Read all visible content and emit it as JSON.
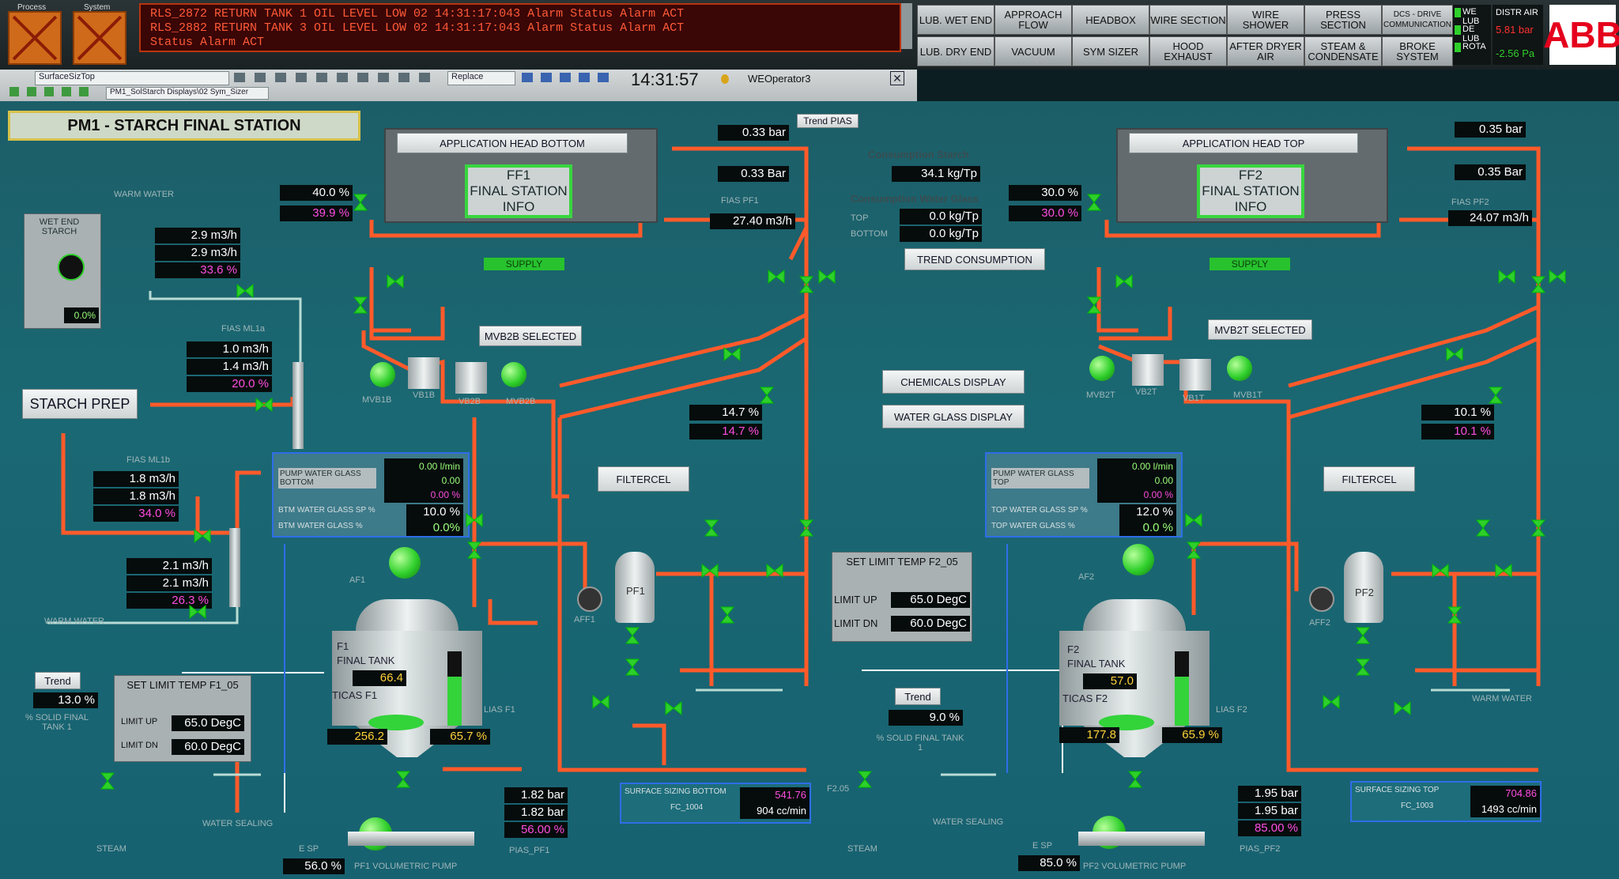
{
  "header": {
    "alarm_lines": [
      "RLS_2872      RETURN TANK 1 OIL LEVEL LOW    02 14:31:17:043  Alarm          Status Alarm    ACT",
      "RLS_2882      RETURN TANK 3 OIL LEVEL LOW    02 14:31:17:043  Alarm          Status Alarm    ACT",
      "                                                                             Status Alarm    ACT"
    ],
    "left_tabs": [
      "Process",
      "System"
    ],
    "nav_buttons_row1": [
      "LUB. WET END",
      "APPROACH FLOW",
      "HEADBOX",
      "WIRE SECTION",
      "WIRE SHOWER",
      "PRESS SECTION",
      "DCS - DRIVE COMMUNICATION"
    ],
    "nav_buttons_row2": [
      "LUB. DRY END",
      "VACUUM",
      "SYM SIZER",
      "HOOD EXHAUST",
      "AFTER DRYER AIR",
      "STEAM & CONDENSATE",
      "BROKE SYSTEM"
    ],
    "status_small": [
      "WE LUB",
      "DE LUB",
      "ROTA"
    ],
    "distr_air_label": "DISTR AIR",
    "distr_air_value1": "5.81 bar",
    "distr_air_value2": "-2.56 Pa",
    "logo": "ABB"
  },
  "toolbar": {
    "combo1": "SurfaceSizTop",
    "combo2": "PM1_SolStarch Displays\\02 Sym_Sizer",
    "replace": "Replace",
    "clock": "14:31:57",
    "user": "WEOperator3"
  },
  "page_title": "PM1 -  STARCH  FINAL STATION",
  "trend_pias": "Trend PIAS",
  "left": {
    "app_head_title": "APPLICATION HEAD BOTTOM",
    "info": [
      "FF1",
      "FINAL STATION",
      "INFO"
    ],
    "supply": "SUPPLY",
    "pias_top": "0.33 bar",
    "pias_2": "0.33 Bar",
    "fias_pf1": "FIAS PF1",
    "flow_pf1": "27.40 m3/h",
    "valve_pos1": "40.0 %",
    "valve_sp1": "39.9 %",
    "warm_water": "WARM WATER",
    "wet_end_starch": "WET END STARCH",
    "wet_end_value": "0.0%",
    "mlb_flows": [
      "2.9 m3/h",
      "2.9 m3/h",
      "33.6 %"
    ],
    "fias_ml1a": "FIAS ML1a",
    "ml1a_flows": [
      "1.0 m3/h",
      "1.4 m3/h",
      "20.0 %"
    ],
    "starch_prep": "STARCH PREP",
    "fias_ml1b": "FIAS ML1b",
    "ml1b_flows": [
      "1.8 m3/h",
      "1.8 m3/h",
      "34.0 %"
    ],
    "ml1c_flows": [
      "2.1 m3/h",
      "2.1 m3/h",
      "26.3 %"
    ],
    "mvb2b_selected": "MVB2B SELECTED",
    "pump_mixers": [
      "MVB1B",
      "VB1B",
      "VB2B",
      "MVB2B"
    ],
    "pump_water_glass": "PUMP WATER GLASS BOTTOM",
    "pwg_vals": [
      "0.00 l/min",
      "0.00",
      "0.00 %"
    ],
    "btm_wg_sp": "BTM WATER GLASS SP %",
    "btm_wg_sp_val": "10.0 %",
    "btm_wg": "BTM WATER GLASS %",
    "btm_wg_val": "0.0%",
    "filtercel": "FILTERCEL",
    "valve23_vals": [
      "14.7 %",
      "14.7 %"
    ],
    "af": "AF1",
    "pf": "PF1",
    "aff": "AFF1",
    "tank_label": [
      "F1",
      "FINAL TANK"
    ],
    "tank_level": "66.4",
    "ticas": "TICAS F1",
    "tank_temp": "256.2",
    "tank_pct": "65.7 %",
    "lias": "LIAS F1",
    "trend": "Trend",
    "solid_val": "13.0 %",
    "solid_label": "% SOLID FINAL TANK 1",
    "setlimit_title": "SET LIMIT TEMP F1_05",
    "limit_up": "LIMIT UP",
    "limit_up_val": "65.0 DegC",
    "limit_dn": "LIMIT DN",
    "limit_dn_val": "60.0 DegC",
    "steam": "STEAM",
    "water_sealing": "WATER SEALING",
    "pump_press": [
      "1.82 bar",
      "1.82 bar",
      "56.00 %"
    ],
    "pias_pf": "PIAS_PF1",
    "esp_val": "56.0 %",
    "esp": "E SP",
    "volumetric": "PF1 VOLUMETRIC PUMP",
    "surface_sizing": "SURFACE SIZING BOTTOM",
    "fc": "FC_1004",
    "ss_vals": [
      "541.76 cc/min",
      "904 cc/min"
    ],
    "warm_water2": "WARM WATER"
  },
  "center": {
    "consumption_starch": "Consumption Starch",
    "consumption_starch_val": "34.1 kg/Tp",
    "consumption_wg": "Consumption Water Glass",
    "top": "TOP",
    "top_val": "0.0 kg/Tp",
    "bottom": "BOTTOM",
    "bottom_val": "0.0 kg/Tp",
    "trend_consumption": "TREND CONSUMPTION",
    "chemicals_display": "CHEMICALS DISPLAY",
    "water_glass_display": "WATER GLASS DISPLAY",
    "setlimit_title": "SET LIMIT TEMP F2_05",
    "limit_up": "LIMIT UP",
    "limit_up_val": "65.0 DegC",
    "limit_dn": "LIMIT DN",
    "limit_dn_val": "60.0 DegC",
    "trend": "Trend",
    "solid_val": "9.0 %",
    "solid_label": "% SOLID FINAL TANK 1",
    "steam": "STEAM",
    "f205": "F2.05"
  },
  "right": {
    "app_head_title": "APPLICATION HEAD TOP",
    "info": [
      "FF2",
      "FINAL STATION",
      "INFO"
    ],
    "supply": "SUPPLY",
    "pias_top": "0.35 bar",
    "pias_2": "0.35 Bar",
    "fias_pf2": "FIAS PF2",
    "flow_pf2": "24.07 m3/h",
    "valve_pos1": "30.0 %",
    "valve_sp1": "30.0 %",
    "mvb2t_selected": "MVB2T SELECTED",
    "pump_mixers": [
      "MVB2T",
      "VB2T",
      "VB1T",
      "MVB1T"
    ],
    "pump_water_glass": "PUMP WATER GLASS TOP",
    "pwg_vals": [
      "0.00 l/min",
      "0.00",
      "0.00 %"
    ],
    "top_wg_sp": "TOP WATER GLASS SP %",
    "top_wg_sp_val": "12.0 %",
    "top_wg": "TOP WATER GLASS %",
    "top_wg_val": "0.0 %",
    "filtercel": "FILTERCEL",
    "valve23_vals": [
      "10.1 %",
      "10.1 %"
    ],
    "af": "AF2",
    "pf": "PF2",
    "aff": "AFF2",
    "tank_label": [
      "F2",
      "FINAL TANK"
    ],
    "tank_level": "57.0",
    "ticas": "TICAS F2",
    "tank_temp": "177.8",
    "tank_pct": "65.9 %",
    "lias": "LIAS F2",
    "water_sealing": "WATER SEALING",
    "pump_press": [
      "1.95 bar",
      "1.95 bar",
      "85.00 %"
    ],
    "pias_pf": "PIAS_PF2",
    "esp_val": "85.0 %",
    "esp": "E SP",
    "volumetric": "PF2 VOLUMETRIC PUMP",
    "surface_sizing": "SURFACE SIZING TOP",
    "fc": "FC_1003",
    "ss_vals": [
      "704.86 cc/min",
      "1493 cc/min"
    ],
    "warm_water": "WARM WATER"
  },
  "tags": {
    "left": [
      "F1.19",
      "CF1",
      "F1.20",
      "F1.21",
      "F1.22",
      "F1.18",
      "F1.17",
      "F1.15",
      "F1.16",
      "F1.23",
      "FF1.11",
      "FF1.10",
      "F1.13",
      "F1.12",
      "F1.11",
      "F1.14",
      "FF1.01",
      "FF1.05",
      "FF1.06",
      "FF1.02",
      "FF1.04",
      "FF1.07",
      "F1.01",
      "F1.05",
      "ML1b.05",
      "E1",
      "M"
    ],
    "right": [
      "F2.19",
      "CF2",
      "F2.20",
      "F2.21",
      "F2.22",
      "F2.18",
      "F2.17",
      "F2.15",
      "F2.16",
      "F2.23",
      "FF2.11",
      "FF2.10",
      "F2.13",
      "F2.12",
      "F2.11",
      "F2.14",
      "FF2.01",
      "FF2.05",
      "FF2.06",
      "FF2.02",
      "FF2.04",
      "FF2.07",
      "F2.01"
    ]
  },
  "colors": {
    "pipe": "#ff5a2a",
    "water_pipe": "#b8dcd4",
    "green": "#2fcf2b",
    "magenta": "#ff4de0",
    "background": "#1a6873"
  }
}
